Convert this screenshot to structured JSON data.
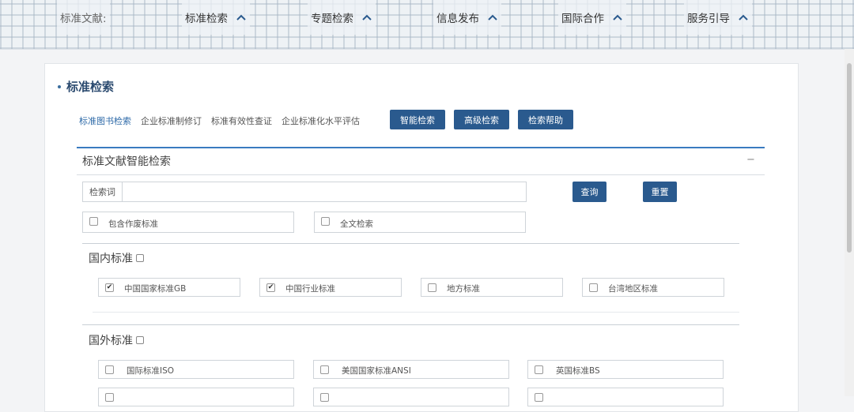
{
  "nav": {
    "label": "标准文献:",
    "items": [
      "标准检索",
      "专题检索",
      "信息发布",
      "国际合作",
      "服务引导"
    ]
  },
  "panel": {
    "title": "标准检索",
    "subtabs": [
      "标准图书检索",
      "企业标准制修订",
      "标准有效性查证",
      "企业标准化水平评估"
    ],
    "buttons": {
      "smart": "智能检索",
      "advanced": "高级检索",
      "help": "检索帮助"
    }
  },
  "smart_search": {
    "title": "标准文献智能检索",
    "collapse": "−",
    "keyword_label": "检索词",
    "keyword_value": "",
    "query_button": "查询",
    "reset_button": "重置",
    "options": [
      {
        "label": "包含作废标准",
        "checked": false
      },
      {
        "label": "全文检索",
        "checked": false
      }
    ]
  },
  "domestic": {
    "title": "国内标准",
    "items": [
      {
        "label": "中国国家标准GB",
        "checked": true
      },
      {
        "label": "中国行业标准",
        "checked": true
      },
      {
        "label": "地方标准",
        "checked": false
      },
      {
        "label": "台湾地区标准",
        "checked": false
      }
    ]
  },
  "foreign": {
    "title": "国外标准",
    "items": [
      {
        "label": "国际标准ISO",
        "checked": false
      },
      {
        "label": "美国国家标准ANSI",
        "checked": false
      },
      {
        "label": "英国标准BS",
        "checked": false
      }
    ]
  },
  "colors": {
    "accent": "#2a5a8e",
    "active_tab": "#2e6aa8",
    "divider": "#3a7bc0"
  },
  "check_glyph": "✔"
}
